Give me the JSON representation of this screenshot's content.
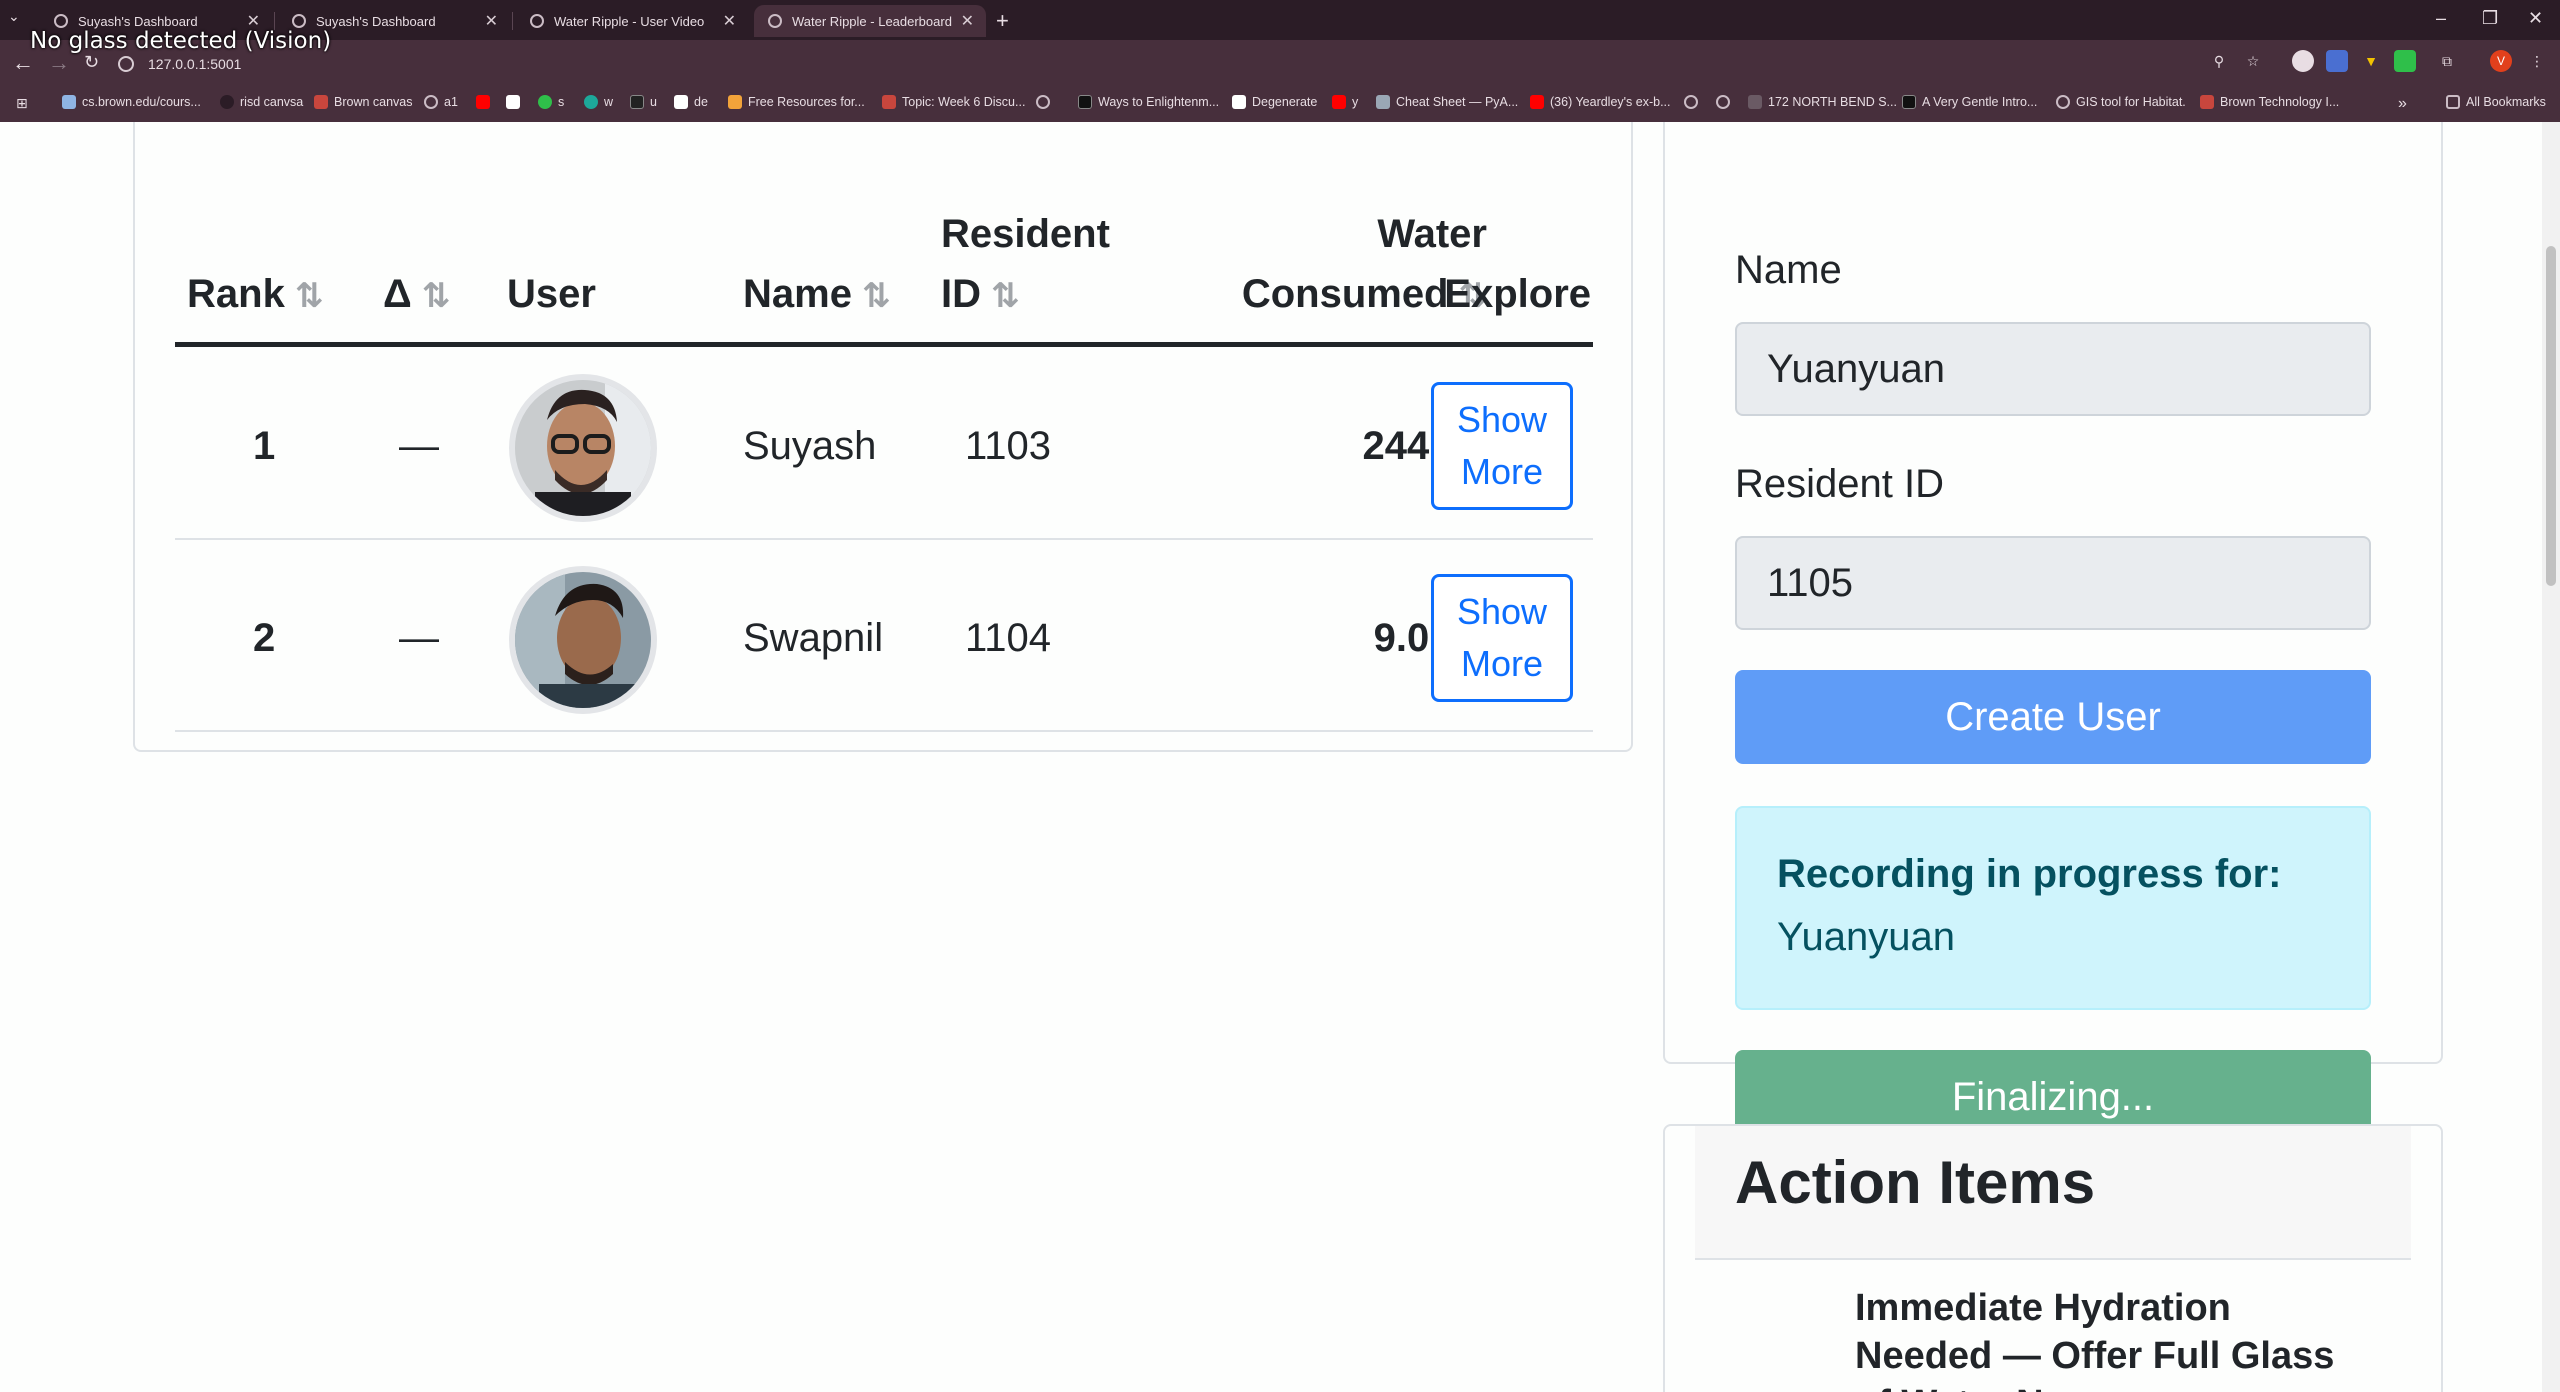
{
  "browser": {
    "tabs": [
      {
        "label": "Suyash's Dashboard",
        "active": false
      },
      {
        "label": "Suyash's Dashboard",
        "active": false
      },
      {
        "label": "Water Ripple - User Video",
        "active": false
      },
      {
        "label": "Water Ripple - Leaderboard",
        "active": true
      }
    ],
    "url": "127.0.0.1:5001",
    "overlay_text": "No glass detected (Vision)",
    "profile_initial": "V",
    "bookmarks": [
      {
        "label": "cs.brown.edu/cours...",
        "color": "#8fb4e3"
      },
      {
        "label": "risd canvsa",
        "color": "#2b1c26"
      },
      {
        "label": "Brown canvas",
        "color": "#c8463d"
      },
      {
        "label": "a1",
        "color": "#cbbcc5"
      },
      {
        "label": "",
        "color": "#ff0000"
      },
      {
        "label": "",
        "color": "#ffffff"
      },
      {
        "label": "s",
        "color": "#2fbf4a"
      },
      {
        "label": "w",
        "color": "#1da89a"
      },
      {
        "label": "u",
        "color": "#222222"
      },
      {
        "label": "de",
        "color": "#ffffff"
      },
      {
        "label": "Free Resources for...",
        "color": "#f2a33a"
      },
      {
        "label": "Topic: Week 6 Discu...",
        "color": "#c8463d"
      },
      {
        "label": "",
        "color": "#cbbcc5"
      },
      {
        "label": "Ways to Enlightenm...",
        "color": "#111111"
      },
      {
        "label": "Degenerate",
        "color": "#ffffff"
      },
      {
        "label": "y",
        "color": "#ff0000"
      },
      {
        "label": "Cheat Sheet — PyA...",
        "color": "#9aa7b5"
      },
      {
        "label": "(36) Yeardley's ex-b...",
        "color": "#ff0000"
      },
      {
        "label": "",
        "color": "#cbbcc5"
      },
      {
        "label": "",
        "color": "#cbbcc5"
      },
      {
        "label": "172 NORTH BEND S...",
        "color": "#6a5a64"
      },
      {
        "label": "A Very Gentle Intro...",
        "color": "#111111"
      },
      {
        "label": "GIS tool for Habitat.",
        "color": "#cbbcc5"
      },
      {
        "label": "Brown Technology I...",
        "color": "#c8463d"
      }
    ],
    "all_bookmarks_label": "All Bookmarks"
  },
  "leaderboard": {
    "headers": {
      "rank": "Rank",
      "delta": "Δ",
      "user": "User",
      "name": "Name",
      "resident_id_line1": "Resident",
      "resident_id_line2": "ID",
      "water_line1": "Water",
      "water_line2": "Consumed",
      "explore": "Explore"
    },
    "rows": [
      {
        "rank": "1",
        "delta": "—",
        "name": "Suyash",
        "resident_id": "1103",
        "water": "244 ml",
        "explore_line1": "Show",
        "explore_line2": "More"
      },
      {
        "rank": "2",
        "delta": "—",
        "name": "Swapnil",
        "resident_id": "1104",
        "water": "9.0 ml",
        "explore_line1": "Show",
        "explore_line2": "More"
      }
    ]
  },
  "form": {
    "name_label": "Name",
    "name_value": "Yuanyuan",
    "resident_label": "Resident ID",
    "resident_value": "1105",
    "create_button": "Create User",
    "recording_title": "Recording in progress for:",
    "recording_name": "Yuanyuan",
    "finalize_button": "Finalizing..."
  },
  "action_items": {
    "title": "Action Items",
    "first_item": "Immediate Hydration Needed — Offer Full Glass of Water Now"
  }
}
